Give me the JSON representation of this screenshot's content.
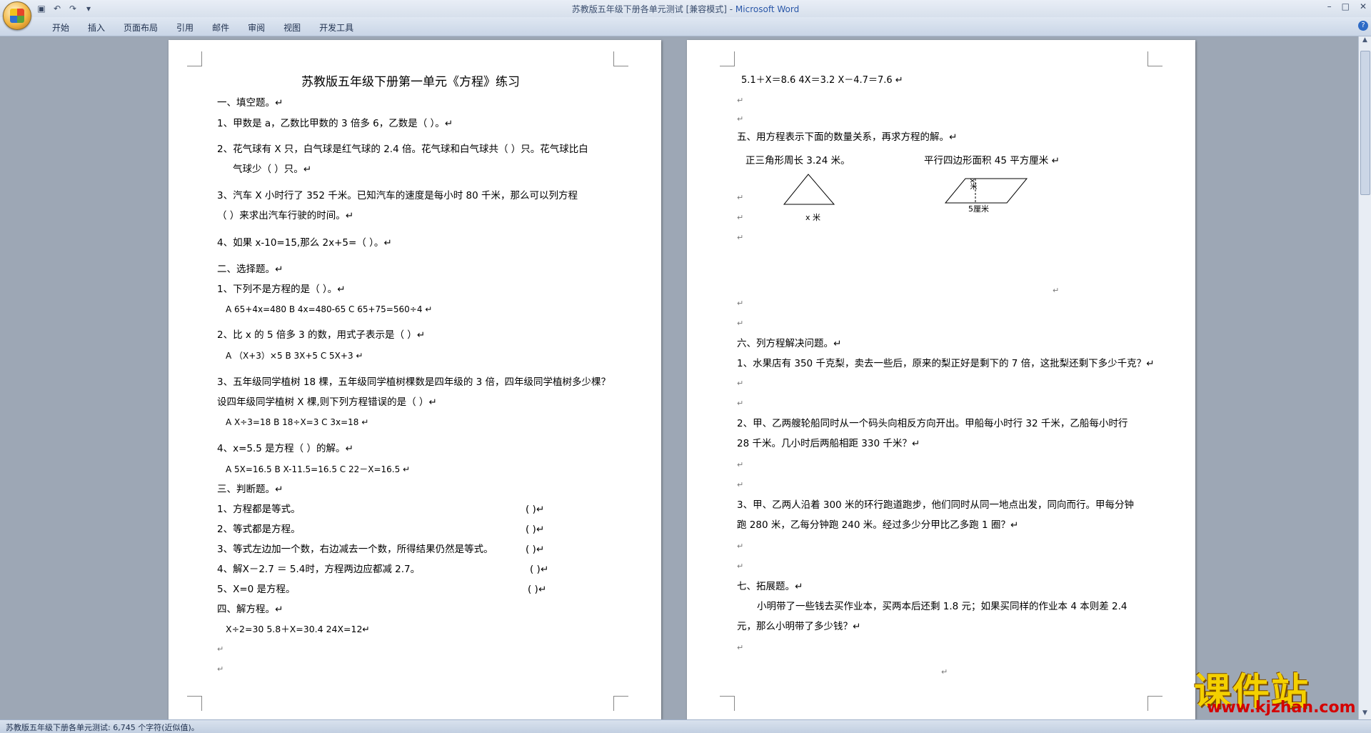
{
  "window": {
    "title": "苏教版五年级下册各单元测试 [兼容模式] - ",
    "app_name": "Microsoft Word",
    "controls": [
      "–",
      "□",
      "✕"
    ]
  },
  "ribbon": {
    "tabs": [
      "开始",
      "插入",
      "页面布局",
      "引用",
      "邮件",
      "审阅",
      "视图",
      "开发工具"
    ],
    "help": "?"
  },
  "qat": [
    "save-icon",
    "undo-icon",
    "redo-icon",
    "customize-icon"
  ],
  "status": {
    "text": "苏教版五年级下册各单元测试: 6,745 个字符(近似值)。"
  },
  "page1": {
    "title": "苏教版五年级下册第一单元《方程》练习",
    "lines": [
      "一、填空题。↵",
      "1、甲数是 a，乙数比甲数的 3 倍多 6，乙数是（                 ）。↵",
      "2、花气球有 X 只，白气球是红气球的 2.4 倍。花气球和白气球共（          ）只。花气球比白",
      "气球少（                  ）只。↵",
      "3、汽车 X 小时行了 352 千米。已知汽车的速度是每小时 80 千米，那么可以列方程",
      "（                      ）来求出汽车行驶的时间。↵",
      "4、如果 x-10=15,那么 2x+5=（               ）。↵",
      "二、选择题。↵",
      "1、下列不是方程的是（         ）。↵",
      "A  65+4x=480            B   4x=480-65        C   65+75=560÷4      ↵",
      "2、比 x 的 5 倍多 3 的数，用式子表示是（       ）↵",
      "A  （X+3）×5            B    3X+5            C    5X+3             ↵",
      "3、五年级同学植树 18 棵，五年级同学植树棵数是四年级的 3 倍，四年级同学植树多少棵？",
      "设四年级同学植树 X 棵,则下列方程错误的是（      ）↵",
      "A   X÷3=18           B   18÷X=3             C  3x=18          ↵",
      "4、x=5.5 是方程（          ）的解。↵",
      "A 5X=16.5            B   X-11.5=16.5         C    22－X=16.5       ↵",
      "三、判断题。↵",
      "1、方程都是等式。",
      "2、等式都是方程。",
      "3、等式左边加一个数，右边减去一个数，所得结果仍然是等式。",
      "4、解X－2.7 ＝ 5.4时，方程两边应都减 2.7。",
      "5、X=0 是方程。",
      "四、解方程。↵",
      "X÷2=30                     5.8＋X=30.4                    24X=12↵",
      "↵",
      "↵"
    ],
    "judge_brackets": [
      "(      )↵",
      "(      )↵",
      "(      )↵",
      "(      )↵",
      "(      )↵"
    ]
  },
  "page2": {
    "lines": [
      "5.1＋X＝8.6               4X＝3.2                X－4.7＝7.6        ↵",
      "↵",
      "↵",
      "五、用方程表示下面的数量关系，再求方程的解。↵",
      "正三角形周长 3.24 米。",
      "平行四边形面积 45  平方厘米    ↵",
      "↵",
      "↵",
      "↵",
      "↵",
      "↵",
      "↵",
      "六、列方程解决问题。↵",
      "1、水果店有 350 千克梨，卖去一些后，原来的梨正好是剩下的 7 倍，这批梨还剩下多少千克？↵",
      "↵",
      "↵",
      "2、甲、乙两艘轮船同时从一个码头向相反方向开出。甲船每小时行 32 千米，乙船每小时行",
      "28 千米。几小时后两船相距 330 千米？↵",
      "↵",
      "↵",
      "3、甲、乙两人沿着 300 米的环行跑道跑步，他们同时从同一地点出发，同向而行。甲每分钟",
      "跑 280 米，乙每分钟跑 240 米。经过多少分甲比乙多跑 1 圈？↵",
      "↵",
      "↵",
      "七、拓展题。↵",
      "小明带了一些钱去买作业本，买两本后还剩 1.8 元；如果买同样的作业本 4 本则差 2.4",
      "元，那么小明带了多少钱？↵",
      "↵",
      "↵"
    ],
    "fig_triangle_label": "x  米",
    "fig_para_label": "5厘米",
    "fig_para_height": "x米"
  },
  "watermark": {
    "big": "课件站",
    "url": "www.kjzhan.com"
  }
}
